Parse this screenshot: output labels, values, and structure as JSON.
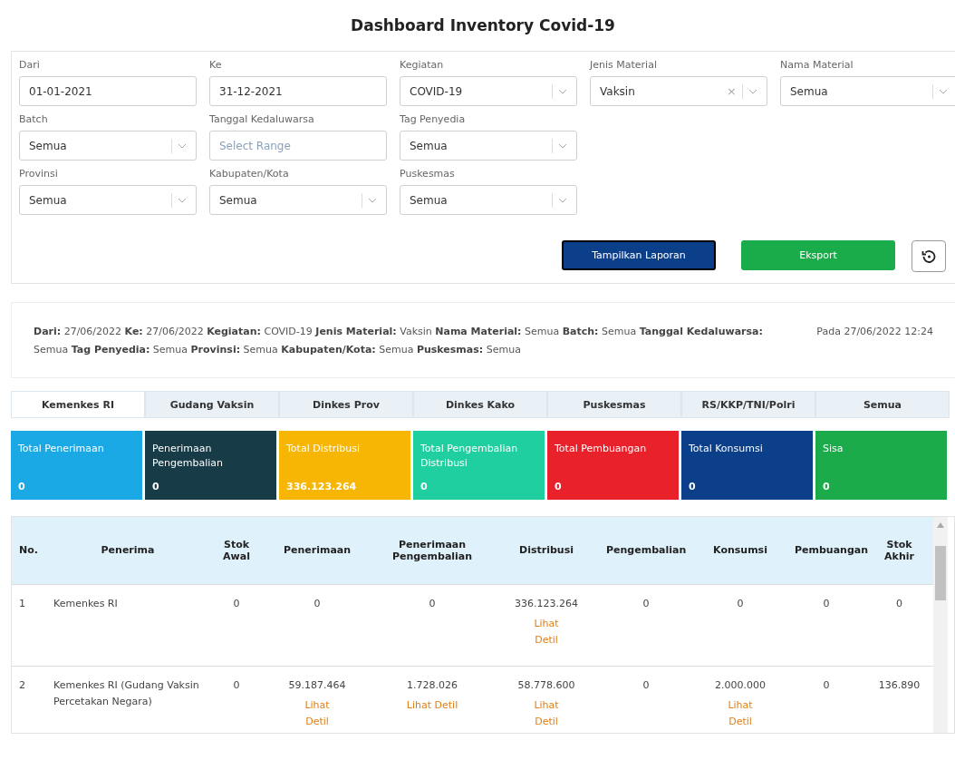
{
  "title": "Dashboard Inventory Covid-19",
  "filters": [
    [
      {
        "label": "Dari",
        "kind": "text",
        "value": "01-01-2021"
      },
      {
        "label": "Ke",
        "kind": "text",
        "value": "31-12-2021"
      },
      {
        "label": "Kegiatan",
        "kind": "select",
        "value": "COVID-19"
      },
      {
        "label": "Jenis Material",
        "kind": "select",
        "value": "Vaksin",
        "clear": "×"
      },
      {
        "label": "Nama Material",
        "kind": "select",
        "value": "Semua"
      }
    ],
    [
      {
        "label": "Batch",
        "kind": "select",
        "value": "Semua"
      },
      {
        "label": "Tanggal Kedaluwarsa",
        "kind": "text",
        "placeholder": "Select Range"
      },
      {
        "label": "Tag Penyedia",
        "kind": "select",
        "value": "Semua"
      }
    ],
    [
      {
        "label": "Provinsi",
        "kind": "select",
        "value": "Semua"
      },
      {
        "label": "Kabupaten/Kota",
        "kind": "select",
        "value": "Semua"
      },
      {
        "label": "Puskesmas",
        "kind": "select",
        "value": "Semua"
      }
    ]
  ],
  "buttons": {
    "report": "Tampilkan Laporan",
    "export": "Eksport"
  },
  "summary": {
    "text": "**Dari:** 27/06/2022 **Ke:** 27/06/2022 **Kegiatan:** COVID-19 **Jenis Material:** Vaksin **Nama Material:** Semua **Batch:** Semua **Tanggal Kedaluwarsa:** Semua **Tag Penyedia:** Semua **Provinsi:** Semua **Kabupaten/Kota:** Semua **Puskesmas:** Semua",
    "timestamp": "Pada 27/06/2022 12:24"
  },
  "tabs": [
    {
      "label": "Kemenkes RI",
      "selected": true
    },
    {
      "label": "Gudang Vaksin",
      "selected": false
    },
    {
      "label": "Dinkes Prov",
      "selected": false
    },
    {
      "label": "Dinkes Kako",
      "selected": false
    },
    {
      "label": "Puskesmas",
      "selected": false
    },
    {
      "label": "RS/KKP/TNI/Polri",
      "selected": false
    },
    {
      "label": "Semua",
      "selected": false
    }
  ],
  "cards": [
    {
      "label": "Total Penerimaan",
      "value": "0",
      "color": "#1ba9e6"
    },
    {
      "label": "Penerimaan Pengembalian",
      "value": "0",
      "color": "#173b47"
    },
    {
      "label": "Total Distribusi",
      "value": "336.123.264",
      "color": "#f6b603"
    },
    {
      "label": "Total Pengembalian Distribusi",
      "value": "0",
      "color": "#1fcf9f"
    },
    {
      "label": "Total Pembuangan",
      "value": "0",
      "color": "#e8212b"
    },
    {
      "label": "Total Konsumsi",
      "value": "0",
      "color": "#0b3f8a"
    },
    {
      "label": "Sisa",
      "value": "0",
      "color": "#1bab4b"
    }
  ],
  "table": {
    "columns": [
      "No.",
      "Penerima",
      "Stok Awal",
      "Penerimaan",
      "Penerimaan Pengembalian",
      "Distribusi",
      "Pengembalian",
      "Konsumsi",
      "Pembuangan",
      "Stok Akhir"
    ],
    "rows": [
      [
        {
          "value": "1"
        },
        {
          "value": "Kemenkes RI"
        },
        {
          "value": "0"
        },
        {
          "value": "0"
        },
        {
          "value": "0"
        },
        {
          "value": "336.123.264",
          "link": "Lihat Detil"
        },
        {
          "value": "0"
        },
        {
          "value": "0"
        },
        {
          "value": "0"
        },
        {
          "value": "0"
        }
      ],
      [
        {
          "value": "2"
        },
        {
          "value": "Kemenkes RI (Gudang Vaksin Percetakan Negara)"
        },
        {
          "value": "0"
        },
        {
          "value": "59.187.464",
          "link": "Lihat Detil"
        },
        {
          "value": "1.728.026",
          "link": "Lihat Detil"
        },
        {
          "value": "58.778.600",
          "link": "Lihat Detil"
        },
        {
          "value": "0"
        },
        {
          "value": "2.000.000",
          "link": "Lihat Detil"
        },
        {
          "value": "0"
        },
        {
          "value": "136.890"
        }
      ]
    ]
  }
}
